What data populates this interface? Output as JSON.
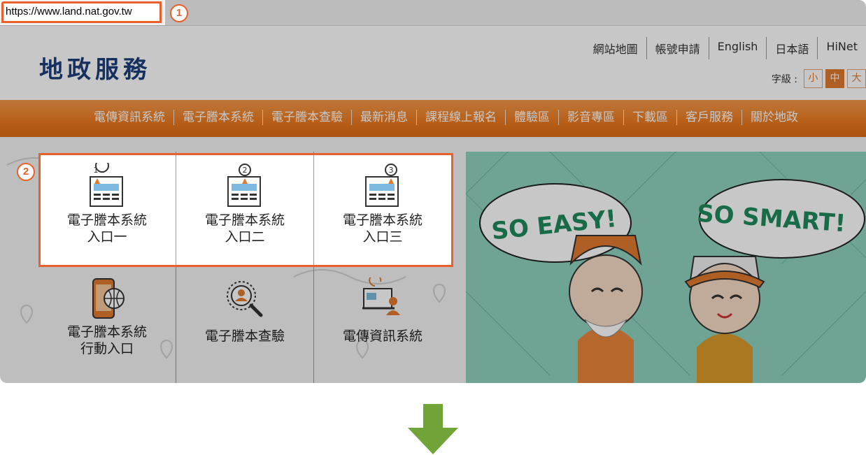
{
  "browser": {
    "url": "https://www.land.nat.gov.tw"
  },
  "callouts": {
    "one": "1",
    "two": "2"
  },
  "header": {
    "logo": "地政服務",
    "top_links": [
      "網站地圖",
      "帳號申請",
      "English",
      "日本語",
      "HiNet"
    ],
    "font_size_label": "字級 :",
    "font_sizes": [
      "小",
      "中",
      "大"
    ]
  },
  "nav": {
    "items": [
      "電傳資訊系統",
      "電子謄本系統",
      "電子謄本查驗",
      "最新消息",
      "課程線上報名",
      "體驗區",
      "影音專區",
      "下載區",
      "客戶服務",
      "關於地政"
    ]
  },
  "tiles": {
    "t1": {
      "line1": "電子謄本系統",
      "line2": "入口一"
    },
    "t2": {
      "line1": "電子謄本系統",
      "line2": "入口二"
    },
    "t3": {
      "line1": "電子謄本系統",
      "line2": "入口三"
    },
    "t4": {
      "line1": "電子謄本系統",
      "line2": "行動入口"
    },
    "t5": {
      "line1": "電子謄本查驗"
    },
    "t6": {
      "line1": "電傳資訊系統"
    }
  },
  "banner": {
    "bubble_left": "SO EASY!",
    "bubble_right": "SO SMART!"
  },
  "colors": {
    "accent": "#e8612c",
    "nav": "#ec7a1f",
    "logo": "#1d3f7a",
    "banner": "#8fd1be",
    "arrow": "#70a438"
  }
}
